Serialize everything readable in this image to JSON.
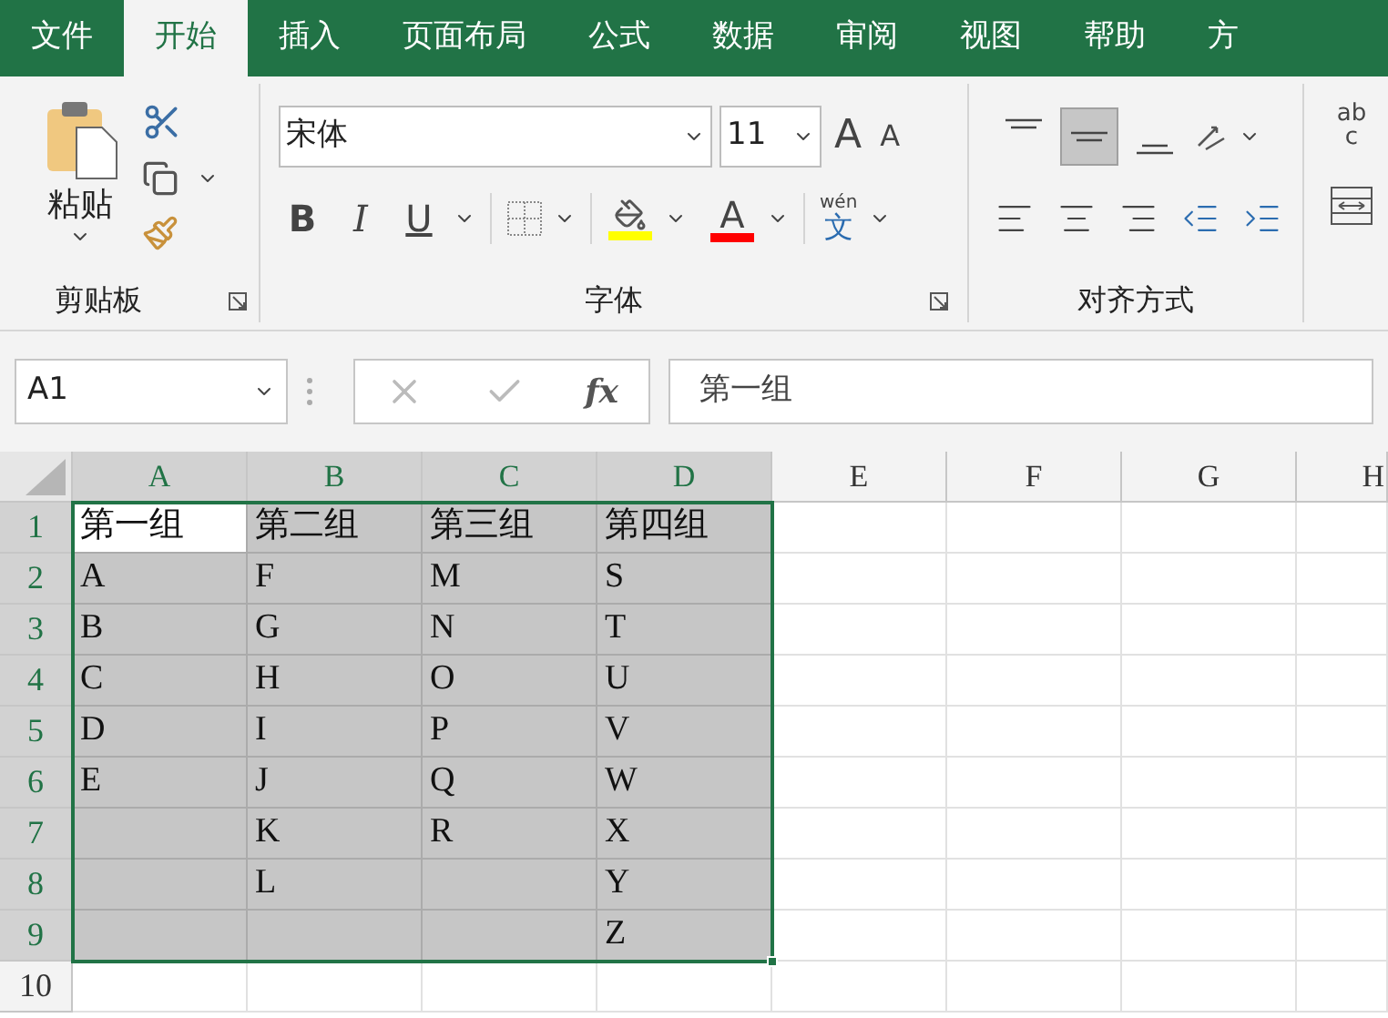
{
  "tabs": [
    {
      "label": "文件",
      "selected": false
    },
    {
      "label": "开始",
      "selected": true
    },
    {
      "label": "插入",
      "selected": false
    },
    {
      "label": "页面布局",
      "selected": false
    },
    {
      "label": "公式",
      "selected": false
    },
    {
      "label": "数据",
      "selected": false
    },
    {
      "label": "审阅",
      "selected": false
    },
    {
      "label": "视图",
      "selected": false
    },
    {
      "label": "帮助",
      "selected": false
    },
    {
      "label": "方",
      "selected": false
    }
  ],
  "clipboard": {
    "paste_label": "粘贴",
    "group_label": "剪贴板"
  },
  "font": {
    "name": "宋体",
    "size": "11",
    "grow_label": "A",
    "shrink_label": "A",
    "bold_label": "B",
    "italic_label": "I",
    "underline_label": "U",
    "color_buttons": [
      {
        "kind": "fill",
        "color": "#ffff00"
      },
      {
        "kind": "font",
        "color": "#ff0000",
        "label": "A"
      }
    ],
    "phonetic_top": "wén",
    "phonetic_char": "文",
    "group_label": "字体"
  },
  "alignment": {
    "top_buttons": [
      {
        "kind": "top",
        "selected": false
      },
      {
        "kind": "middle",
        "selected": true
      },
      {
        "kind": "bottom",
        "selected": false
      }
    ],
    "bottom_buttons": [
      {
        "kind": "left",
        "selected": false
      },
      {
        "kind": "center",
        "selected": false
      },
      {
        "kind": "right",
        "selected": false
      },
      {
        "kind": "outdent",
        "selected": false
      },
      {
        "kind": "indent",
        "selected": false
      }
    ],
    "group_label": "对齐方式"
  },
  "wrap": {
    "top": "ab",
    "bottom": "c"
  },
  "name_box": "A1",
  "fx_label": "fx",
  "formula": "第一组",
  "grid": {
    "columns": [
      {
        "label": "A",
        "selected": true
      },
      {
        "label": "B",
        "selected": true
      },
      {
        "label": "C",
        "selected": true
      },
      {
        "label": "D",
        "selected": true
      },
      {
        "label": "E",
        "selected": false
      },
      {
        "label": "F",
        "selected": false
      },
      {
        "label": "G",
        "selected": false
      },
      {
        "label": "H",
        "selected": false
      }
    ],
    "rows": [
      {
        "label": "1",
        "selected": true,
        "cells": [
          {
            "text": "第一组",
            "selected": true,
            "active": true
          },
          {
            "text": "第二组",
            "selected": true,
            "active": false
          },
          {
            "text": "第三组",
            "selected": true,
            "active": false
          },
          {
            "text": "第四组",
            "selected": true,
            "active": false
          },
          {
            "selected": false,
            "active": false
          },
          {
            "selected": false,
            "active": false
          },
          {
            "selected": false,
            "active": false
          },
          {
            "selected": false,
            "active": false
          }
        ]
      },
      {
        "label": "2",
        "selected": true,
        "cells": [
          {
            "text": "A",
            "selected": true,
            "active": false
          },
          {
            "text": "F",
            "selected": true,
            "active": false
          },
          {
            "text": "M",
            "selected": true,
            "active": false
          },
          {
            "text": "S",
            "selected": true,
            "active": false
          },
          {
            "selected": false,
            "active": false
          },
          {
            "selected": false,
            "active": false
          },
          {
            "selected": false,
            "active": false
          },
          {
            "selected": false,
            "active": false
          }
        ]
      },
      {
        "label": "3",
        "selected": true,
        "cells": [
          {
            "text": "B",
            "selected": true,
            "active": false
          },
          {
            "text": "G",
            "selected": true,
            "active": false
          },
          {
            "text": "N",
            "selected": true,
            "active": false
          },
          {
            "text": "T",
            "selected": true,
            "active": false
          },
          {
            "selected": false,
            "active": false
          },
          {
            "selected": false,
            "active": false
          },
          {
            "selected": false,
            "active": false
          },
          {
            "selected": false,
            "active": false
          }
        ]
      },
      {
        "label": "4",
        "selected": true,
        "cells": [
          {
            "text": "C",
            "selected": true,
            "active": false
          },
          {
            "text": "H",
            "selected": true,
            "active": false
          },
          {
            "text": "O",
            "selected": true,
            "active": false
          },
          {
            "text": "U",
            "selected": true,
            "active": false
          },
          {
            "selected": false,
            "active": false
          },
          {
            "selected": false,
            "active": false
          },
          {
            "selected": false,
            "active": false
          },
          {
            "selected": false,
            "active": false
          }
        ]
      },
      {
        "label": "5",
        "selected": true,
        "cells": [
          {
            "text": "D",
            "selected": true,
            "active": false
          },
          {
            "text": "I",
            "selected": true,
            "active": false
          },
          {
            "text": "P",
            "selected": true,
            "active": false
          },
          {
            "text": "V",
            "selected": true,
            "active": false
          },
          {
            "selected": false,
            "active": false
          },
          {
            "selected": false,
            "active": false
          },
          {
            "selected": false,
            "active": false
          },
          {
            "selected": false,
            "active": false
          }
        ]
      },
      {
        "label": "6",
        "selected": true,
        "cells": [
          {
            "text": "E",
            "selected": true,
            "active": false
          },
          {
            "text": "J",
            "selected": true,
            "active": false
          },
          {
            "text": "Q",
            "selected": true,
            "active": false
          },
          {
            "text": "W",
            "selected": true,
            "active": false
          },
          {
            "selected": false,
            "active": false
          },
          {
            "selected": false,
            "active": false
          },
          {
            "selected": false,
            "active": false
          },
          {
            "selected": false,
            "active": false
          }
        ]
      },
      {
        "label": "7",
        "selected": true,
        "cells": [
          {
            "selected": true,
            "active": false
          },
          {
            "text": "K",
            "selected": true,
            "active": false
          },
          {
            "text": "R",
            "selected": true,
            "active": false
          },
          {
            "text": "X",
            "selected": true,
            "active": false
          },
          {
            "selected": false,
            "active": false
          },
          {
            "selected": false,
            "active": false
          },
          {
            "selected": false,
            "active": false
          },
          {
            "selected": false,
            "active": false
          }
        ]
      },
      {
        "label": "8",
        "selected": true,
        "cells": [
          {
            "selected": true,
            "active": false
          },
          {
            "text": "L",
            "selected": true,
            "active": false
          },
          {
            "selected": true,
            "active": false
          },
          {
            "text": "Y",
            "selected": true,
            "active": false
          },
          {
            "selected": false,
            "active": false
          },
          {
            "selected": false,
            "active": false
          },
          {
            "selected": false,
            "active": false
          },
          {
            "selected": false,
            "active": false
          }
        ]
      },
      {
        "label": "9",
        "selected": true,
        "cells": [
          {
            "selected": true,
            "active": false
          },
          {
            "selected": true,
            "active": false
          },
          {
            "selected": true,
            "active": false
          },
          {
            "text": "Z",
            "selected": true,
            "active": false
          },
          {
            "selected": false,
            "active": false
          },
          {
            "selected": false,
            "active": false
          },
          {
            "selected": false,
            "active": false
          },
          {
            "selected": false,
            "active": false
          }
        ]
      },
      {
        "label": "10",
        "selected": false,
        "cells": [
          {
            "selected": false,
            "active": false
          },
          {
            "selected": false,
            "active": false
          },
          {
            "selected": false,
            "active": false
          },
          {
            "selected": false,
            "active": false
          },
          {
            "selected": false,
            "active": false
          },
          {
            "selected": false,
            "active": false
          },
          {
            "selected": false,
            "active": false
          },
          {
            "selected": false,
            "active": false
          }
        ]
      }
    ]
  }
}
